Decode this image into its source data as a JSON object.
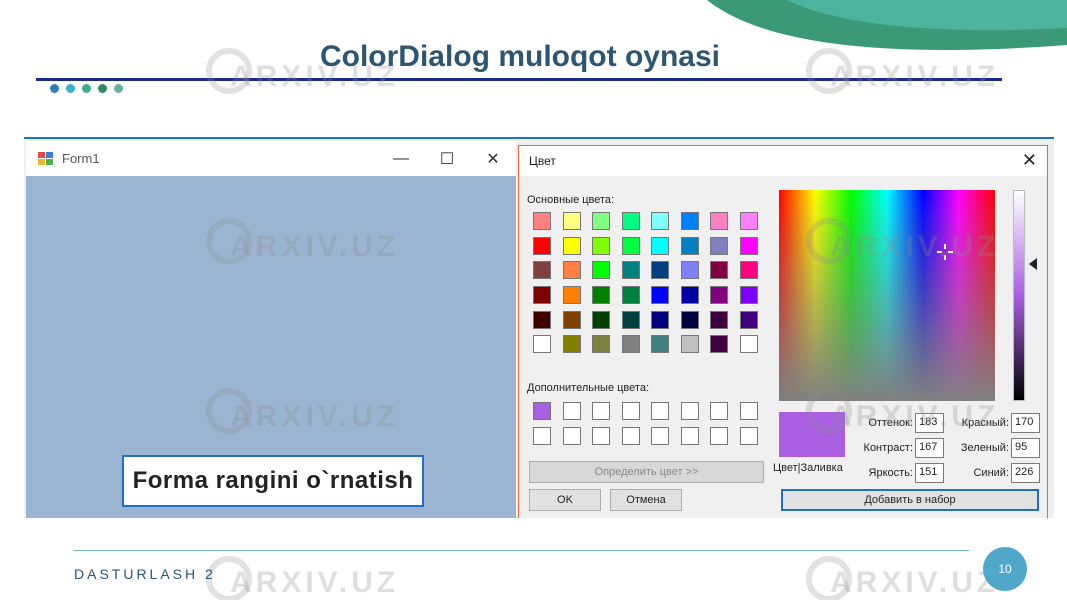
{
  "slide": {
    "title": "ColorDialog muloqot oynasi",
    "footer": "DASTURLASH 2",
    "page_number": "10",
    "dot_colors": [
      "#2a7fb8",
      "#35b3c9",
      "#3aae8e",
      "#2e8a60",
      "#67b0a6"
    ],
    "watermark": "ARXIV.UZ",
    "accent_color": "#1a2b8c"
  },
  "form1": {
    "title": "Form1",
    "icon": "app-window-icon",
    "minimize_icon": "minimize-icon",
    "maximize_icon": "maximize-icon",
    "close_icon": "close-icon",
    "background_color": "#9ab4d2",
    "button_label": "Forma rangini o`rnatish"
  },
  "color_dialog": {
    "title": "Цвет",
    "basic_colors_label": "Основные цвета:",
    "custom_colors_label": "Дополнительные цвета:",
    "basic_colors": [
      "#ff8080",
      "#ffff80",
      "#80ff80",
      "#00ff80",
      "#80ffff",
      "#0080ff",
      "#ff80c0",
      "#ff80ff",
      "#ff0000",
      "#ffff00",
      "#80ff00",
      "#00ff40",
      "#00ffff",
      "#0080c0",
      "#8080c0",
      "#ff00ff",
      "#804040",
      "#ff8040",
      "#00ff00",
      "#008080",
      "#004080",
      "#8080ff",
      "#800040",
      "#ff0080",
      "#800000",
      "#ff8000",
      "#008000",
      "#008040",
      "#0000ff",
      "#0000a0",
      "#800080",
      "#8000ff",
      "#400000",
      "#804000",
      "#004000",
      "#004040",
      "#000080",
      "#000040",
      "#400040",
      "#400080",
      "#ffffff",
      "#808000",
      "#808040",
      "#808080",
      "#408080",
      "#c0c0c0",
      "#400040",
      "#ffffff"
    ],
    "custom_colors": [
      "#aa5fe2",
      "#ffffff",
      "#ffffff",
      "#ffffff",
      "#ffffff",
      "#ffffff",
      "#ffffff",
      "#ffffff",
      "#ffffff",
      "#ffffff",
      "#ffffff",
      "#ffffff",
      "#ffffff",
      "#ffffff",
      "#ffffff",
      "#ffffff"
    ],
    "define_button": "Определить цвет >>",
    "ok_button": "OK",
    "cancel_button": "Отмена",
    "add_button": "Добавить в набор",
    "preview_label": "Цвет|Заливка",
    "preview_color": "#aa5fe2",
    "hue_label": "Оттенок:",
    "hue": "183",
    "sat_label": "Контраст:",
    "sat": "167",
    "lum_label": "Яркость:",
    "lum": "151",
    "red_label": "Красный:",
    "red": "170",
    "green_label": "Зеленый:",
    "green": "95",
    "blue_label": "Синий:",
    "blue": "226"
  }
}
